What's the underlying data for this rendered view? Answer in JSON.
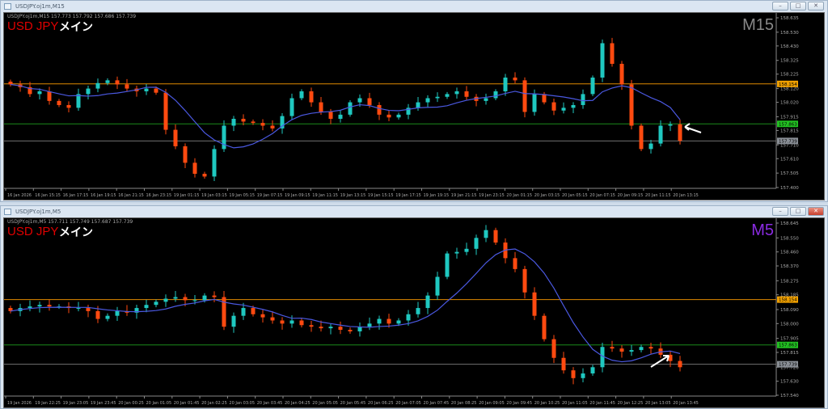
{
  "colors": {
    "bull": "#1fc8c0",
    "bear": "#ff4a10",
    "ma": "#4a58e0",
    "orange_line": "#e08a00",
    "green_line": "#1a8a1a",
    "gray_line": "#707070"
  },
  "windows": [
    {
      "title": "USDJPY.oj1m,M15",
      "info": "USDJPY.oj1m,M15  157.773 157.792 157.686 157.739",
      "symbol": "USD JPY",
      "label": "メイン",
      "timeframe": "M15",
      "timeframe_color": "#888888",
      "buttons": [
        "–",
        "□",
        "✕"
      ],
      "price_labels": [
        "158.635",
        "158.530",
        "158.430",
        "158.325",
        "158.225",
        "158.120",
        "158.020",
        "157.915",
        "157.815",
        "157.710",
        "157.610",
        "157.505",
        "157.400"
      ],
      "levels": [
        {
          "price": "158.154",
          "kind": "orange"
        },
        {
          "price": "157.863",
          "kind": "green"
        },
        {
          "price": "157.739",
          "kind": "gray"
        }
      ],
      "time_labels": [
        "16 Jan 2026",
        "16 Jan 15:15",
        "16 Jan 17:15",
        "16 Jan 19:15",
        "16 Jan 21:15",
        "16 Jan 23:15",
        "19 Jan 01:15",
        "19 Jan 03:15",
        "19 Jan 05:15",
        "19 Jan 07:15",
        "19 Jan 09:15",
        "19 Jan 11:15",
        "19 Jan 13:15",
        "19 Jan 15:15",
        "19 Jan 17:15",
        "19 Jan 19:15",
        "19 Jan 21:15",
        "19 Jan 23:15",
        "20 Jan 01:15",
        "20 Jan 03:15",
        "20 Jan 05:15",
        "20 Jan 07:15",
        "20 Jan 09:15",
        "20 Jan 11:15",
        "20 Jan 13:15"
      ],
      "ylim": [
        157.4,
        158.635
      ],
      "closes": [
        158.15,
        158.13,
        158.08,
        158.1,
        158.03,
        158.0,
        157.98,
        158.08,
        158.12,
        158.16,
        158.18,
        158.15,
        158.12,
        158.1,
        158.12,
        158.09,
        157.82,
        157.7,
        157.58,
        157.5,
        157.48,
        157.68,
        157.85,
        157.9,
        157.88,
        157.87,
        157.85,
        157.83,
        157.92,
        158.05,
        158.1,
        158.02,
        157.95,
        157.9,
        157.93,
        158.02,
        158.05,
        158.0,
        157.93,
        157.91,
        157.93,
        157.98,
        158.02,
        158.05,
        158.06,
        158.08,
        158.1,
        158.06,
        158.03,
        158.05,
        158.1,
        158.2,
        158.18,
        157.95,
        158.08,
        158.02,
        157.96,
        157.98,
        158.0,
        158.08,
        158.2,
        158.45,
        158.3,
        158.15,
        157.85,
        157.68,
        157.72,
        157.85,
        157.86,
        157.74
      ]
    },
    {
      "title": "USDJPY.oj1m,M5",
      "info": "USDJPY.oj1m,M5  157.711 157.749 157.687 157.739",
      "symbol": "USD JPY",
      "label": "メイン",
      "timeframe": "M5",
      "timeframe_color": "#8a2be2",
      "buttons": [
        "–",
        "□",
        "✕"
      ],
      "price_labels": [
        "158.645",
        "158.550",
        "158.460",
        "158.370",
        "158.275",
        "158.185",
        "158.090",
        "158.000",
        "157.905",
        "157.815",
        "157.720",
        "157.630",
        "157.540"
      ],
      "levels": [
        {
          "price": "158.154",
          "kind": "orange"
        },
        {
          "price": "157.863",
          "kind": "green"
        },
        {
          "price": "157.739",
          "kind": "gray"
        }
      ],
      "time_labels": [
        "19 Jan 2026",
        "19 Jan 22:25",
        "19 Jan 23:05",
        "19 Jan 23:45",
        "20 Jan 00:25",
        "20 Jan 01:05",
        "20 Jan 01:45",
        "20 Jan 02:25",
        "20 Jan 03:05",
        "20 Jan 03:45",
        "20 Jan 04:25",
        "20 Jan 05:05",
        "20 Jan 05:45",
        "20 Jan 06:25",
        "20 Jan 07:05",
        "20 Jan 07:45",
        "20 Jan 08:25",
        "20 Jan 09:05",
        "20 Jan 09:45",
        "20 Jan 10:25",
        "20 Jan 11:05",
        "20 Jan 11:45",
        "20 Jan 12:25",
        "20 Jan 13:05",
        "20 Jan 13:45"
      ],
      "ylim": [
        157.54,
        158.645
      ],
      "closes": [
        158.08,
        158.1,
        158.11,
        158.12,
        158.11,
        158.11,
        158.1,
        158.1,
        158.08,
        158.03,
        158.05,
        158.08,
        158.07,
        158.1,
        158.12,
        158.14,
        158.16,
        158.17,
        158.15,
        158.15,
        158.18,
        158.17,
        157.98,
        158.05,
        158.1,
        158.06,
        158.04,
        158.02,
        158.0,
        158.02,
        157.99,
        157.98,
        157.97,
        157.98,
        157.96,
        157.95,
        157.98,
        158.0,
        158.03,
        158.0,
        158.02,
        158.06,
        158.1,
        158.18,
        158.3,
        158.45,
        158.46,
        158.48,
        158.55,
        158.6,
        158.52,
        158.42,
        158.35,
        158.2,
        158.05,
        157.9,
        157.78,
        157.7,
        157.65,
        157.68,
        157.72,
        157.85,
        157.84,
        157.82,
        157.83,
        157.85,
        157.84,
        157.8,
        157.76,
        157.72
      ]
    }
  ]
}
